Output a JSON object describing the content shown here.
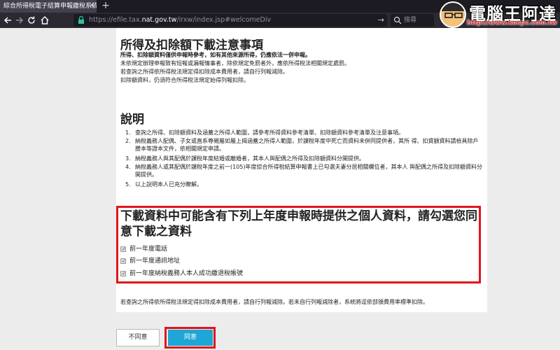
{
  "browser": {
    "tab_title": "綜合所得稅電子結算申報繳稅系統",
    "tab_close": "✕",
    "new_tab": "+",
    "url_scheme": "https://",
    "url_pre": "efile.tax.",
    "url_host": "nat.gov.tw",
    "url_path": "/irxw/index.jsp#welcomeDiv",
    "search_placeholder": "搜尋"
  },
  "watermark": {
    "title": "電腦王阿達",
    "url": "http://www.kocpc.com.tw"
  },
  "notice": {
    "title": "所得及扣除額下載注意事項",
    "lines": [
      "所得、扣除額資料僅供申報時參考，如有其他來源所得，仍應依法一併申報。",
      "未依規定辦理申報致有短報或漏報情事者，除依規定免罰者外，應依所得稅法相關規定處罰。",
      "若查詢之所得依所得稅法規定得扣除成本費用者，請自行列報減除。",
      "扣除額資料，仍須符合所得稅法規定始得列報扣除。"
    ]
  },
  "explain": {
    "title": "說明",
    "items": [
      {
        "num": "1.",
        "text": "查詢之所得、扣除額資料及涵蓋之所得人範圍，請參考所得資料參考清單、扣除額資料參考清單及注意事項。"
      },
      {
        "num": "2.",
        "text": "納稅義務人配偶、子女或直系尊親屬如屬上揭涵蓋之所得人範圍，於課稅年度中死亡而資料未併同提供者，其所 得、扣資額資料請檢具除戶謄本等證本文件，依相關規定申請。"
      },
      {
        "num": "3.",
        "text": "納稅義務人與其配偶於課稅年度結婚或離婚者，其本人與配偶之所得及扣除額資料分開提供。"
      },
      {
        "num": "4.",
        "text": "納稅義務人或其配偶於課稅年度之前一(105)年度綜合所得稅結算申報書上已勾選夫妻分居相關欄位者，其本人 與配偶之所得及扣除額資料分開提供。"
      },
      {
        "num": "5.",
        "text": "以上說明本人已充分瞭解。"
      }
    ]
  },
  "consent": {
    "title": "下載資料中可能含有下列上年度申報時提供之個人資料，請勾選您同意下載之資料",
    "options": [
      {
        "label": "前一年度電話",
        "checked": true
      },
      {
        "label": "前一年度通訊地址",
        "checked": true
      },
      {
        "label": "前一年度納稅義務人本人成功繳退稅帳號",
        "checked": true
      }
    ]
  },
  "bottom_note": "若查詢之所得依所得稅法規定得扣除成本費用者，請自行列報減除。若未自行列報減除者，系統將逕依部頒費用率標準扣除。",
  "buttons": {
    "disagree": "不同意",
    "agree": "同意"
  },
  "colors": {
    "highlight": "#e1161b",
    "agree_button": "#1ea6d6"
  }
}
